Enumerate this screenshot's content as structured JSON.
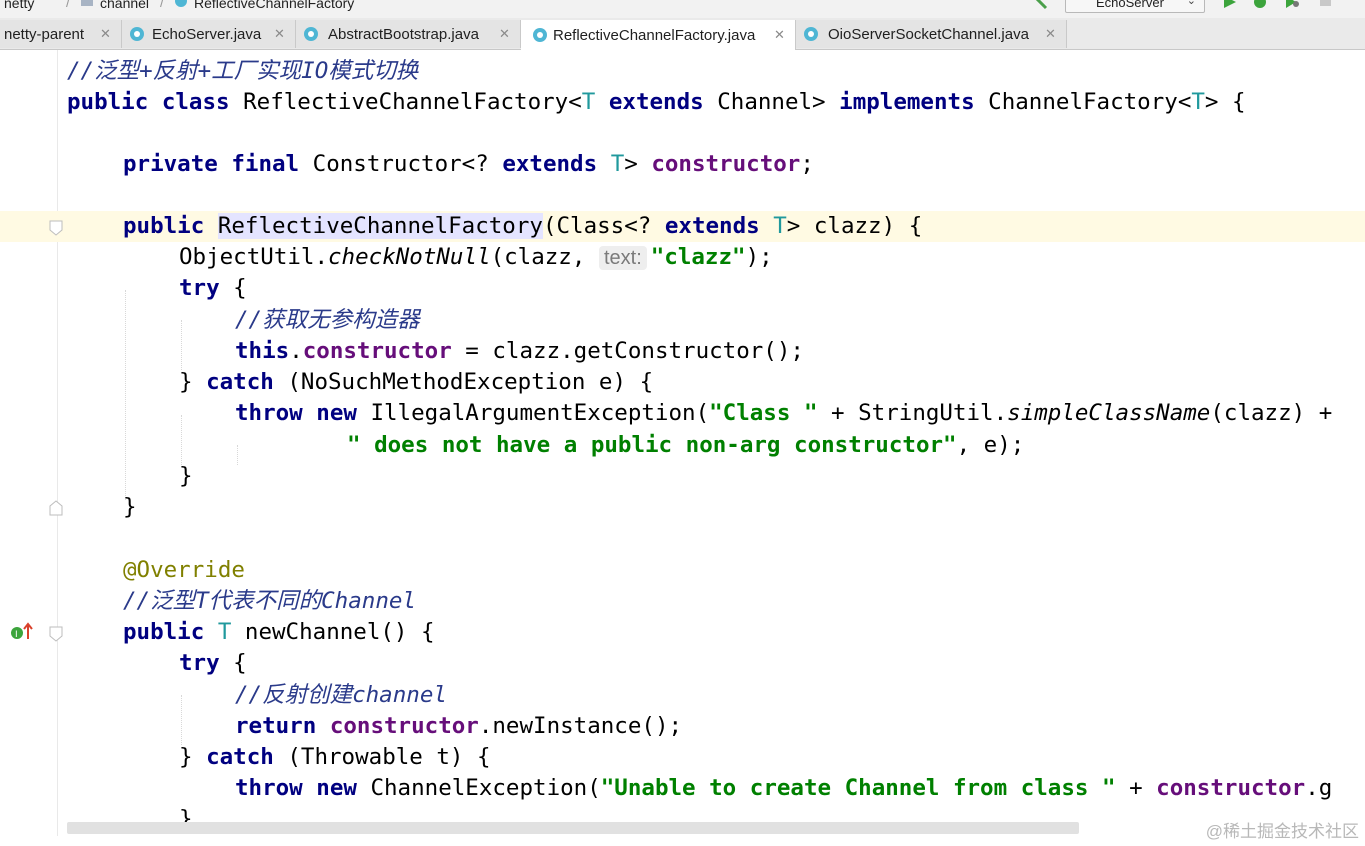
{
  "breadcrumbs": [
    "netty",
    "channel",
    "ReflectiveChannelFactory"
  ],
  "run_config": {
    "label": "EchoServer"
  },
  "tabs": [
    {
      "label": "netty-parent",
      "active": false
    },
    {
      "label": "EchoServer.java",
      "active": false
    },
    {
      "label": "AbstractBootstrap.java",
      "active": false
    },
    {
      "label": "ReflectiveChannelFactory.java",
      "active": true
    },
    {
      "label": "OioServerSocketChannel.java",
      "active": false
    }
  ],
  "code": {
    "l01": {
      "comment": "//泛型+反射+工厂实现IO模式切换"
    },
    "l02": {
      "k1": "public",
      "k2": "class",
      "t1": " ReflectiveChannelFactory<",
      "t2": "T",
      "k3": "extends",
      "t3": " Channel> ",
      "k4": "implements",
      "t4": " ChannelFactory<",
      "t5": "T",
      "t6": "> {"
    },
    "l04": {
      "k1": "private",
      "k2": "final",
      "t1": " Constructor<? ",
      "k3": "extends",
      "t2": "T",
      "t3": "> ",
      "f1": "constructor",
      "t4": ";"
    },
    "l06": {
      "k1": "public",
      "name": "ReflectiveChannelFactory",
      "t1": "(Class<? ",
      "k2": "extends",
      "t2": "T",
      "t3": "> clazz) {"
    },
    "l07": {
      "t1": "ObjectUtil.",
      "m1": "checkNotNull",
      "t2": "(clazz, ",
      "hint": "text:",
      "s1": "\"clazz\"",
      "t3": ");"
    },
    "l08": {
      "k1": "try",
      "t1": " {"
    },
    "l09": {
      "comment": "//获取无参构造器"
    },
    "l10": {
      "k1": "this",
      "t1": ".",
      "f1": "constructor",
      "t2": " = clazz.getConstructor();"
    },
    "l11": {
      "t1": "} ",
      "k1": "catch",
      "t2": " (NoSuchMethodException e) {"
    },
    "l12": {
      "k1": "throw",
      "k2": "new",
      "t1": " IllegalArgumentException(",
      "s1": "\"Class \"",
      "t2": " + StringUtil.",
      "m1": "simpleClassName",
      "t3": "(clazz) +"
    },
    "l13": {
      "s1": "\" does not have a public non-arg constructor\"",
      "t1": ", e);"
    },
    "l14": {
      "t1": "}"
    },
    "l15": {
      "t1": "}"
    },
    "l17": {
      "a1": "@Override"
    },
    "l18": {
      "comment": "//泛型T代表不同的Channel"
    },
    "l19": {
      "k1": "public",
      "t1": "T",
      "t2": " newChannel() {"
    },
    "l20": {
      "k1": "try",
      "t1": " {"
    },
    "l21": {
      "comment": "//反射创建channel"
    },
    "l22": {
      "k1": "return",
      "f1": "constructor",
      "t1": ".newInstance();"
    },
    "l23": {
      "t1": "} ",
      "k1": "catch",
      "t2": " (Throwable t) {"
    },
    "l24": {
      "k1": "throw",
      "k2": "new",
      "t1": " ChannelException(",
      "s1": "\"Unable to create Channel from class \"",
      "t2": " + ",
      "f1": "constructor",
      "t3": ".g"
    },
    "l25": {
      "t1": "}"
    }
  },
  "gutter_marker": {
    "icon": "implements-method-icon"
  },
  "watermark": "@稀土掘金技术社区",
  "colors": {
    "keyword": "#000080",
    "comment": "#2a3a8a",
    "field": "#660e7a",
    "string": "#008000",
    "type_param": "#20999d",
    "annotation": "#808000",
    "current_line": "#fffae3"
  }
}
